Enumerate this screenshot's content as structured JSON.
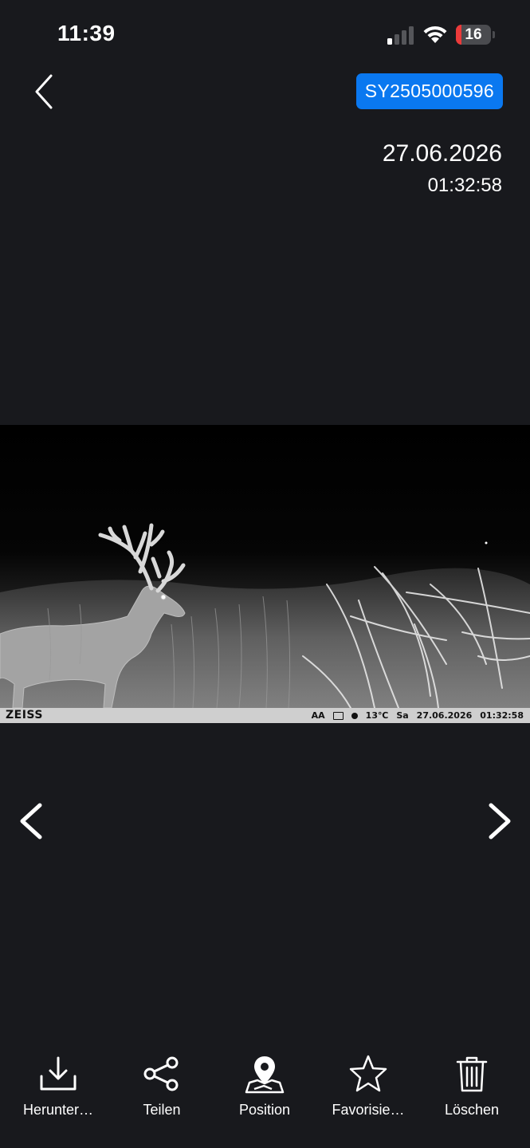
{
  "status_bar": {
    "time": "11:39",
    "battery_level": "16",
    "battery_fraction": 0.16,
    "battery_color": "#ec3a3a",
    "icons": [
      "cellular-signal-icon",
      "wifi-icon",
      "battery-icon"
    ]
  },
  "header": {
    "back_icon": "chevron-left-icon",
    "device_id": "SY2505000596",
    "badge_color": "#0a78f0"
  },
  "capture": {
    "date": "27.06.2026",
    "time": "01:32:58"
  },
  "photo": {
    "brand": "ZEISS",
    "mode": "AA",
    "temperature": "13℃",
    "weekday": "Sa",
    "date": "27.06.2026",
    "time": "01:32:58"
  },
  "navigation": {
    "prev_icon": "chevron-left-icon",
    "next_icon": "chevron-right-icon"
  },
  "toolbar": {
    "download_label": "Herunter…",
    "share_label": "Teilen",
    "position_label": "Position",
    "favorite_label": "Favorisie…",
    "delete_label": "Löschen"
  },
  "colors": {
    "background": "#18191d",
    "accent": "#0a78f0"
  }
}
